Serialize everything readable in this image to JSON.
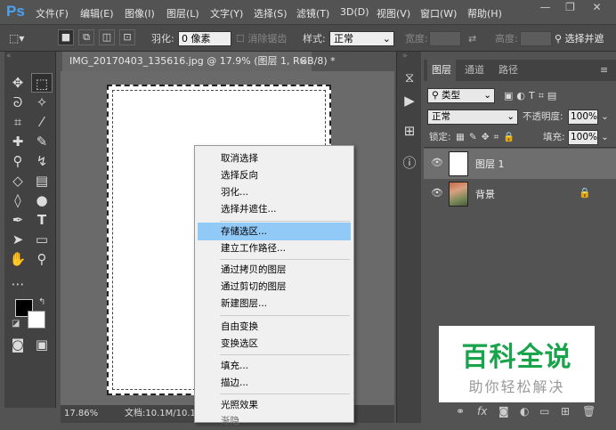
{
  "app": {
    "logo": "Ps"
  },
  "menu": {
    "items": [
      "文件(F)",
      "编辑(E)",
      "图像(I)",
      "图层(L)",
      "文字(Y)",
      "选择(S)",
      "滤镜(T)",
      "3D(D)",
      "视图(V)",
      "窗口(W)",
      "帮助(H)"
    ]
  },
  "window": {
    "minimize": "—",
    "restore": "❐",
    "close": "✕"
  },
  "options": {
    "feather_label": "羽化:",
    "feather_value": "0 像素",
    "antialias_label": "消除锯齿",
    "style_label": "样式:",
    "style_value": "正常",
    "width_label": "宽度:",
    "height_label": "高度:",
    "select_mask_label": "选择并遮"
  },
  "document": {
    "tab_title": "IMG_20170403_135616.jpg @ 17.9% (图层 1, RGB/8) *",
    "tab_close": "×"
  },
  "status": {
    "zoom": "17.86%",
    "doc_info": "文档:10.1M/10.1"
  },
  "context_menu": {
    "items": [
      "取消选择",
      "选择反向",
      "羽化...",
      "选择并遮住...",
      "存储选区...",
      "建立工作路径...",
      "通过拷贝的图层",
      "通过剪切的图层",
      "新建图层...",
      "自由变换",
      "变换选区",
      "填充...",
      "描边...",
      "光照效果",
      "渐隐"
    ],
    "highlighted_index": 4
  },
  "layers_panel": {
    "tabs": [
      "图层",
      "通道",
      "路径"
    ],
    "filter_label": "类型",
    "blend_mode": "正常",
    "opacity_label": "不透明度:",
    "opacity_value": "100%",
    "lock_label": "锁定:",
    "fill_label": "填充:",
    "fill_value": "100%",
    "layers": [
      {
        "name": "图层 1",
        "selected": true
      },
      {
        "name": "背景",
        "locked": true
      }
    ]
  },
  "watermark": {
    "title": "百科全说",
    "subtitle": "助你轻松解决",
    "color": "#19a34b"
  }
}
